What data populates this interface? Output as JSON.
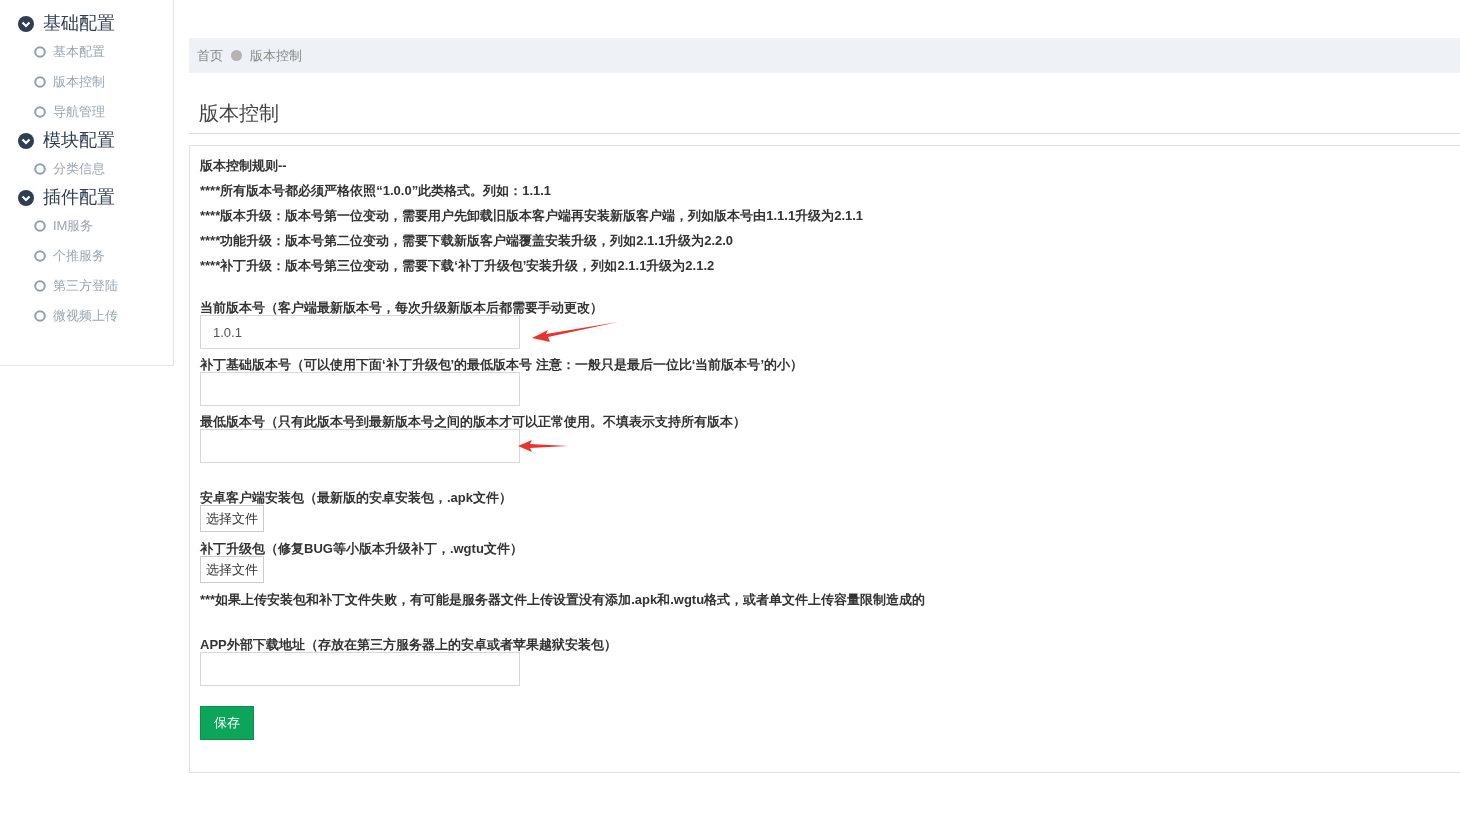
{
  "sidebar": {
    "groups": [
      {
        "title": "基础配置",
        "expanded": true,
        "items": [
          {
            "label": "基本配置"
          },
          {
            "label": "版本控制"
          },
          {
            "label": "导航管理"
          }
        ]
      },
      {
        "title": "模块配置",
        "expanded": true,
        "items": [
          {
            "label": "分类信息"
          }
        ]
      },
      {
        "title": "插件配置",
        "expanded": true,
        "items": [
          {
            "label": "IM服务"
          },
          {
            "label": "个推服务"
          },
          {
            "label": "第三方登陆"
          },
          {
            "label": "微视频上传"
          }
        ]
      }
    ]
  },
  "breadcrumb": [
    "首页",
    "版本控制"
  ],
  "page_title": "版本控制",
  "rules": [
    "版本控制规则--",
    "****所有版本号都必须严格依照“1.0.0”此类格式。列如：1.1.1",
    "****版本升级：版本号第一位变动，需要用户先卸载旧版本客户端再安装新版客户端，列如版本号由1.1.1升级为2.1.1",
    "****功能升级：版本号第二位变动，需要下载新版客户端覆盖安装升级，列如2.1.1升级为2.2.0",
    "****补丁升级：版本号第三位变动，需要下载‘补丁升级包’安装升级，列如2.1.1升级为2.1.2"
  ],
  "form": [
    {
      "kind": "text",
      "label": "当前版本号（客户端最新版本号，每次升级新版本后都需要手动更改）",
      "value": "1.0.1",
      "annotated": true
    },
    {
      "kind": "text",
      "label": "补丁基础版本号（可以使用下面‘补丁升级包’的最低版本号 注意：一般只是最后一位比‘当前版本号’的小）",
      "annotated": false
    },
    {
      "kind": "text",
      "label": "最低版本号（只有此版本号到最新版本号之间的版本才可以正常使用。不填表示支持所有版本）",
      "annotated": true
    },
    {
      "kind": "file",
      "label": "安卓客户端安装包（最新版的安卓安装包，.apk文件）",
      "button": "选择文件"
    },
    {
      "kind": "file",
      "label": "补丁升级包（修复BUG等小版本升级补丁，.wgtu文件）",
      "button": "选择文件"
    },
    {
      "kind": "note",
      "label": "***如果上传安装包和补丁文件失败，有可能是服务器文件上传设置没有添加.apk和.wgtu格式，或者单文件上传容量限制造成的"
    },
    {
      "kind": "text",
      "label": "APP外部下载地址（存放在第三方服务器上的安卓或者苹果越狱安装包）",
      "annotated": false
    }
  ],
  "save_button": "保存"
}
